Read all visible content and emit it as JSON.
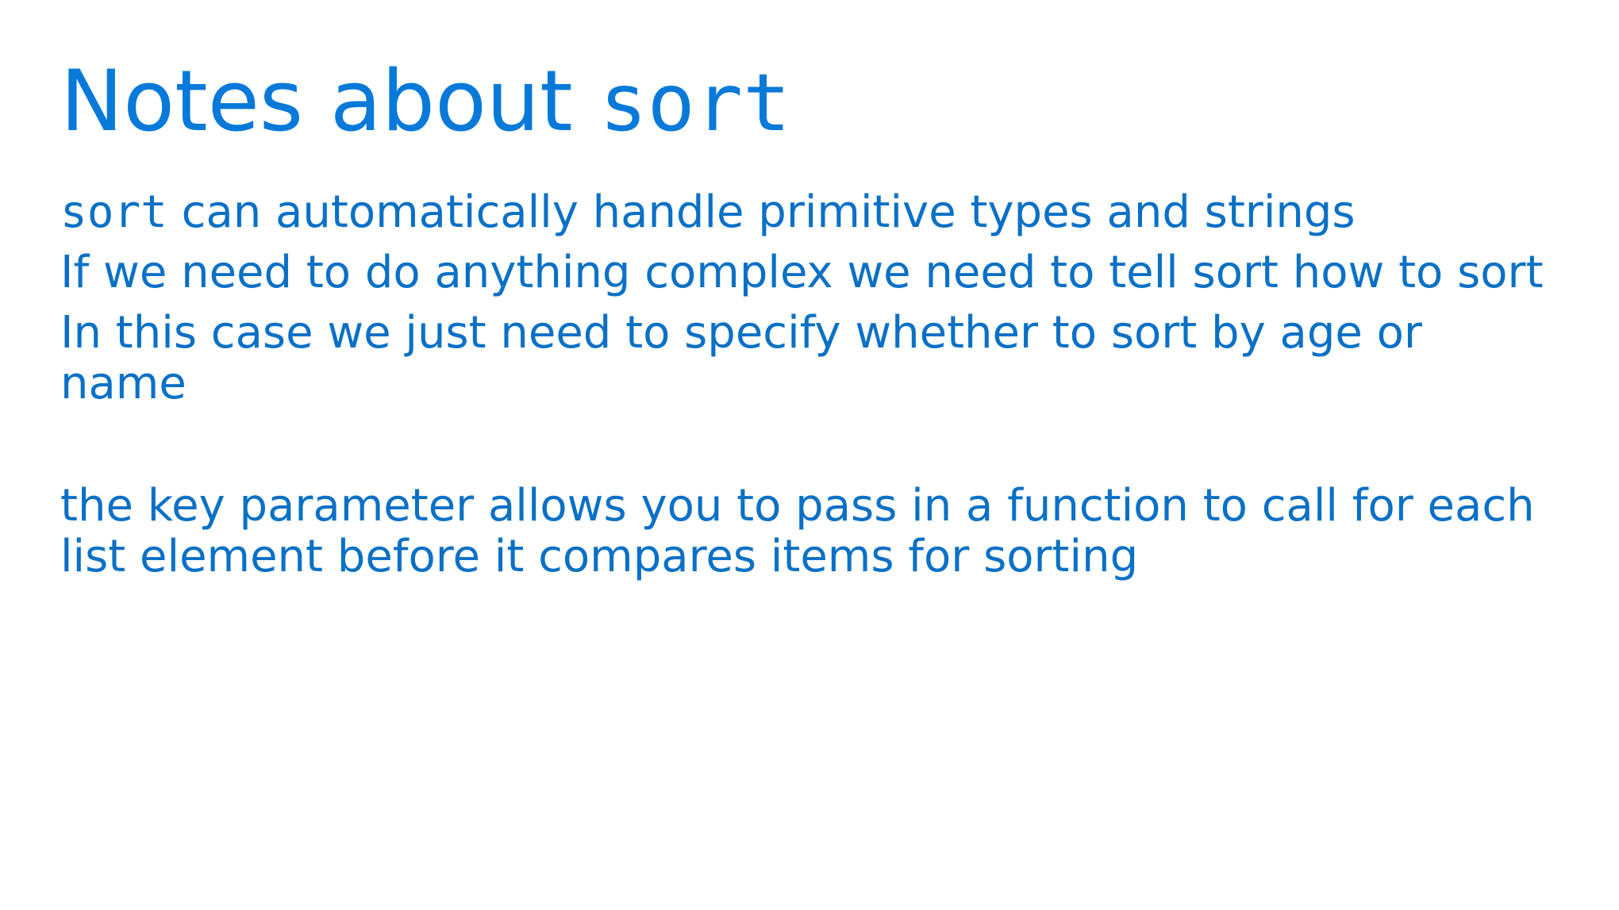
{
  "slide": {
    "title": {
      "text": "Notes about ",
      "code": "sort"
    },
    "paragraphs": {
      "p1": {
        "code": "sort",
        "text": " can automatically handle primitive types and strings"
      },
      "p2": "If we need to do anything complex we need to tell sort how to sort",
      "p3": "In this case we just need to specify whether to sort by age or name",
      "p4": "the key parameter allows you to pass in a function to call for each list element before it compares items for sorting"
    }
  },
  "colors": {
    "title": "#0779d9",
    "body": "#0a70c6",
    "background": "#ffffff"
  }
}
